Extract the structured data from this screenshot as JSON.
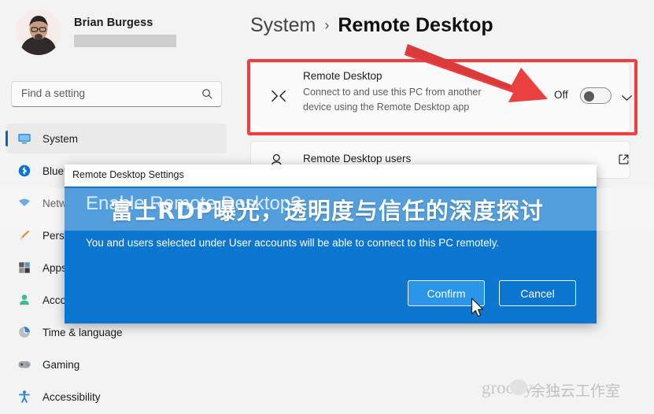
{
  "sidebar": {
    "profile": {
      "name": "Brian Burgess",
      "email_redacted": true
    },
    "search": {
      "placeholder": "Find a setting",
      "value": "",
      "icon": "search-icon"
    },
    "items": [
      {
        "label": "System",
        "icon": "monitor-icon",
        "selected": true
      },
      {
        "label": "Bluetooth & devices",
        "icon": "bluetooth-icon",
        "selected": false
      },
      {
        "label": "Network & internet",
        "icon": "wifi-icon",
        "selected": false
      },
      {
        "label": "Personalization",
        "icon": "brush-icon",
        "selected": false
      },
      {
        "label": "Apps",
        "icon": "apps-icon",
        "selected": false
      },
      {
        "label": "Accounts",
        "icon": "person-icon",
        "selected": false
      },
      {
        "label": "Time & language",
        "icon": "clock-icon",
        "selected": false
      },
      {
        "label": "Gaming",
        "icon": "gamepad-icon",
        "selected": false
      },
      {
        "label": "Accessibility",
        "icon": "accessibility-icon",
        "selected": false
      }
    ]
  },
  "breadcrumb": {
    "root": "System",
    "separator": "›",
    "current": "Remote Desktop"
  },
  "remote_desktop_card": {
    "icon": "remote-desktop-icon",
    "title": "Remote Desktop",
    "description": "Connect to and use this PC from another device using the Remote Desktop app",
    "state_label": "Off",
    "toggle_on": false,
    "expand_icon": "chevron-down-icon"
  },
  "remote_desktop_users_row": {
    "icon": "users-icon",
    "label": "Remote Desktop users",
    "external_icon": "open-external-icon"
  },
  "annotation": {
    "box_color": "#ea4040",
    "arrow_color": "#ea4040",
    "points_to": "remote-desktop-toggle"
  },
  "dialog": {
    "title": "Remote Desktop Settings",
    "heading": "Enable Remote Desktop?",
    "body": "You and users selected under User accounts will be able to connect to this PC remotely.",
    "confirm_label": "Confirm",
    "cancel_label": "Cancel",
    "accent_color": "#0a76cf",
    "confirm_hover_color": "#2b95e9"
  },
  "overlay_banner": {
    "text": "富士RDP曝光，透明度与信任的深度探讨"
  },
  "watermark": {
    "brand": "groovy",
    "chinese": "余独云工作室",
    "badge_icon": "wechat-icon"
  }
}
